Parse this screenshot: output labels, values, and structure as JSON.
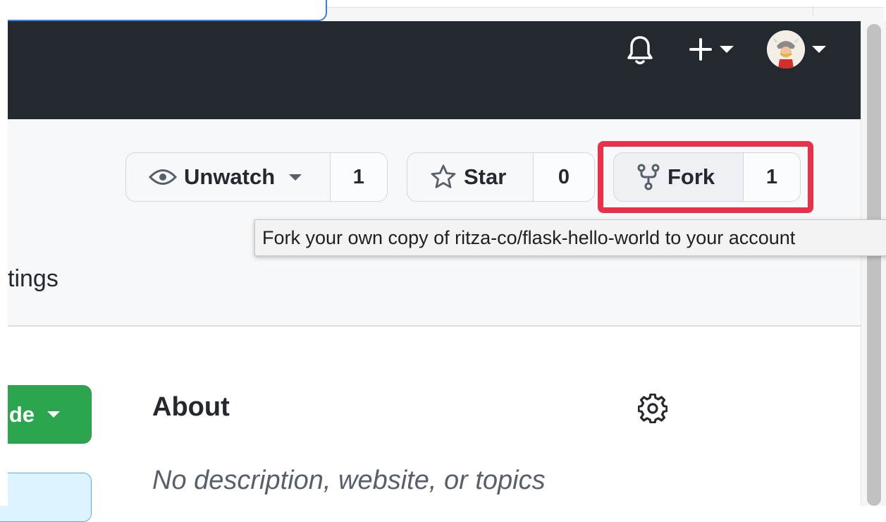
{
  "header": {
    "notifications_icon": "bell-icon",
    "create_icon": "plus-icon",
    "avatar_icon": "user-avatar"
  },
  "repo_actions": {
    "watch": {
      "label": "Unwatch",
      "count": "1",
      "icon": "eye-icon"
    },
    "star": {
      "label": "Star",
      "count": "0",
      "icon": "star-icon"
    },
    "fork": {
      "label": "Fork",
      "count": "1",
      "icon": "repo-forked-icon"
    }
  },
  "tooltip": {
    "text": "Fork your own copy of ritza-co/flask-hello-world to your account"
  },
  "tabs": {
    "settings_partial": "tings"
  },
  "code_button": {
    "label": "de"
  },
  "about": {
    "title": "About",
    "description": "No description, website, or topics",
    "settings_icon": "gear-icon"
  },
  "colors": {
    "header_bg": "#24292f",
    "highlight": "#e8324a",
    "code_green": "#2da44e",
    "repohead_bg": "#f6f8fa"
  }
}
